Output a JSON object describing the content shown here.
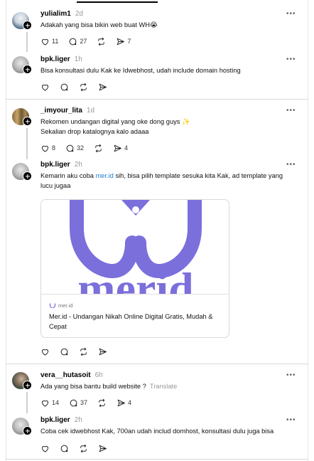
{
  "threads": [
    {
      "post": {
        "username": "yulialim1",
        "time": "2d",
        "text": "Adakah yang bisa bikin web buat WH😭",
        "likes": "11",
        "comments": "27",
        "shares": "7"
      },
      "reply": {
        "username": "bpk.liger",
        "time": "1h",
        "text": "Bisa konsultasi dulu Kak ke Idwebhost, udah include domain hosting"
      }
    },
    {
      "post": {
        "username": "_imyour_lita",
        "time": "1d",
        "text_line1": "Rekomen undangan digital yang oke dong guys ✨",
        "text_line2": "Sekalian drop katalognya kalo adaaa",
        "likes": "8",
        "comments": "32",
        "shares": "4"
      },
      "reply": {
        "username": "bpk.liger",
        "time": "2h",
        "text_before": "Kemarin aku coba ",
        "link": "mer.id",
        "text_after": " sih, bisa pilih template sesuka kita Kak, ad template yang lucu jugaa",
        "card": {
          "domain": "mer.id",
          "title": "Mer.id - Undangan Nikah Online Digital Gratis, Mudah & Cepat",
          "logo_text": "merid"
        }
      }
    },
    {
      "post": {
        "username": "vera__hutasoit",
        "time": "6h",
        "text": "Ada yang bisa bantu build website ?",
        "translate": "Translate",
        "likes": "14",
        "comments": "37",
        "shares": "4"
      },
      "reply": {
        "username": "bpk.liger",
        "time": "2h",
        "text": "Coba cek idwebhost Kak, 700an udah includ domhost, konsultasi dulu juga bisa"
      }
    }
  ],
  "more_glyph": "•••",
  "colors": {
    "link": "#1d7bd7",
    "brand_purple": "#7b6fdc"
  },
  "icons": [
    "heart-icon",
    "comment-icon",
    "repost-icon",
    "share-icon",
    "more-icon",
    "follow-plus-icon"
  ]
}
